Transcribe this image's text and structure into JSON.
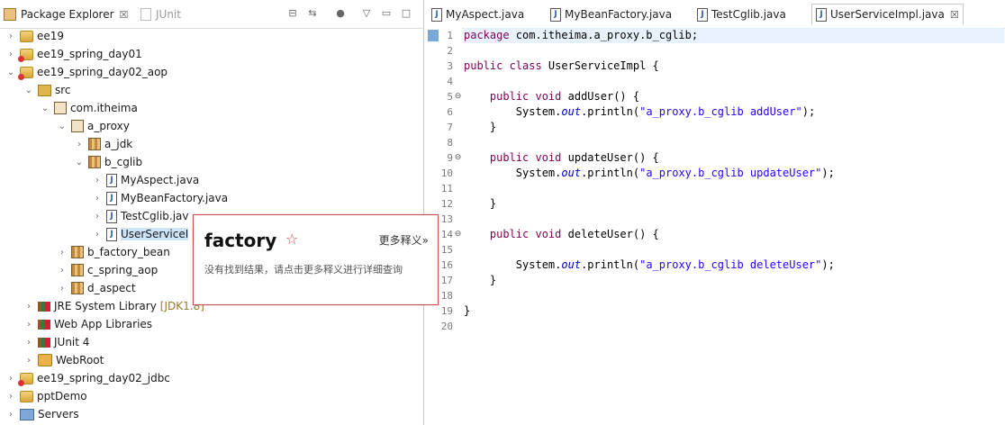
{
  "explorer": {
    "tabs": [
      {
        "label": "Package Explorer",
        "close": "☒",
        "active": true
      },
      {
        "label": "JUnit",
        "active": false
      }
    ],
    "toolbar_icons": [
      "collapse-all-icon",
      "link-with-editor-icon",
      "view-menu-icon",
      "minimize-icon",
      "maximize-icon"
    ],
    "tree": [
      {
        "label": "ee19",
        "icon": "project-icon",
        "expanded": false,
        "error": false
      },
      {
        "label": "ee19_spring_day01",
        "icon": "project-icon",
        "expanded": false,
        "error": true
      },
      {
        "label": "ee19_spring_day02_aop",
        "icon": "project-icon",
        "expanded": true,
        "error": true
      },
      {
        "label": "src",
        "icon": "source-folder-icon",
        "expanded": true
      },
      {
        "label": "com.itheima",
        "icon": "package-icon",
        "expanded": true
      },
      {
        "label": "a_proxy",
        "icon": "package-icon",
        "expanded": true
      },
      {
        "label": "a_jdk",
        "icon": "package-icon",
        "expanded": false
      },
      {
        "label": "b_cglib",
        "icon": "package-icon",
        "expanded": true
      },
      {
        "label": "MyAspect.java",
        "icon": "java-file-icon",
        "expanded": false
      },
      {
        "label": "MyBeanFactory.java",
        "icon": "java-file-icon",
        "expanded": false
      },
      {
        "label": "TestCglib.jav",
        "icon": "java-file-icon",
        "expanded": false
      },
      {
        "label": "UserServiceI",
        "icon": "java-file-icon",
        "expanded": false,
        "selected": true
      },
      {
        "label": "b_factory_bean",
        "icon": "package-icon",
        "expanded": false
      },
      {
        "label": "c_spring_aop",
        "icon": "package-icon",
        "expanded": false
      },
      {
        "label": "d_aspect",
        "icon": "package-icon",
        "expanded": false
      },
      {
        "label": "JRE System Library",
        "decoration": "[JDK1.8]",
        "icon": "library-icon",
        "expanded": false
      },
      {
        "label": "Web App Libraries",
        "icon": "library-icon",
        "expanded": false
      },
      {
        "label": "JUnit 4",
        "icon": "library-icon",
        "expanded": false
      },
      {
        "label": "WebRoot",
        "icon": "web-folder-icon",
        "expanded": false
      },
      {
        "label": "ee19_spring_day02_jdbc",
        "icon": "project-icon",
        "expanded": false,
        "error": true
      },
      {
        "label": "pptDemo",
        "icon": "project-icon",
        "expanded": false,
        "error": false
      },
      {
        "label": "Servers",
        "icon": "servers-folder-icon",
        "expanded": false
      }
    ]
  },
  "editor": {
    "tabs": [
      {
        "label": "MyAspect.java",
        "active": false
      },
      {
        "label": "MyBeanFactory.java",
        "active": false
      },
      {
        "label": "TestCglib.java",
        "active": false
      },
      {
        "label": "UserServiceImpl.java",
        "active": true,
        "close": "☒"
      }
    ],
    "lines": [
      {
        "n": "1",
        "fold": "",
        "tokens": [
          {
            "t": "package",
            "c": "kw"
          },
          {
            "t": " com.itheima.a_proxy.b_cglib;",
            "c": ""
          }
        ]
      },
      {
        "n": "2",
        "fold": "",
        "tokens": []
      },
      {
        "n": "3",
        "fold": "",
        "tokens": [
          {
            "t": "public class",
            "c": "kw"
          },
          {
            "t": " UserServiceImpl {",
            "c": ""
          }
        ]
      },
      {
        "n": "4",
        "fold": "",
        "tokens": []
      },
      {
        "n": "5",
        "fold": "⊖",
        "tokens": [
          {
            "t": "    ",
            "c": ""
          },
          {
            "t": "public void",
            "c": "kw"
          },
          {
            "t": " addUser() {",
            "c": ""
          }
        ]
      },
      {
        "n": "6",
        "fold": "",
        "tokens": [
          {
            "t": "        System.",
            "c": ""
          },
          {
            "t": "out",
            "c": "fld"
          },
          {
            "t": ".println(",
            "c": ""
          },
          {
            "t": "\"a_proxy.b_cglib addUser\"",
            "c": "str"
          },
          {
            "t": ");",
            "c": ""
          }
        ]
      },
      {
        "n": "7",
        "fold": "",
        "tokens": [
          {
            "t": "    }",
            "c": ""
          }
        ]
      },
      {
        "n": "8",
        "fold": "",
        "tokens": []
      },
      {
        "n": "9",
        "fold": "⊖",
        "tokens": [
          {
            "t": "    ",
            "c": ""
          },
          {
            "t": "public void",
            "c": "kw"
          },
          {
            "t": " updateUser() {",
            "c": ""
          }
        ]
      },
      {
        "n": "10",
        "fold": "",
        "tokens": [
          {
            "t": "        System.",
            "c": ""
          },
          {
            "t": "out",
            "c": "fld"
          },
          {
            "t": ".println(",
            "c": ""
          },
          {
            "t": "\"a_proxy.b_cglib updateUser\"",
            "c": "str"
          },
          {
            "t": ");",
            "c": ""
          }
        ]
      },
      {
        "n": "11",
        "fold": "",
        "tokens": []
      },
      {
        "n": "12",
        "fold": "",
        "tokens": [
          {
            "t": "    }",
            "c": ""
          }
        ]
      },
      {
        "n": "13",
        "fold": "",
        "tokens": []
      },
      {
        "n": "14",
        "fold": "⊖",
        "tokens": [
          {
            "t": "    ",
            "c": ""
          },
          {
            "t": "public void",
            "c": "kw"
          },
          {
            "t": " deleteUser() {",
            "c": ""
          }
        ]
      },
      {
        "n": "15",
        "fold": "",
        "tokens": []
      },
      {
        "n": "16",
        "fold": "",
        "tokens": [
          {
            "t": "        System.",
            "c": ""
          },
          {
            "t": "out",
            "c": "fld"
          },
          {
            "t": ".println(",
            "c": ""
          },
          {
            "t": "\"a_proxy.b_cglib deleteUser\"",
            "c": "str"
          },
          {
            "t": ");",
            "c": ""
          }
        ]
      },
      {
        "n": "17",
        "fold": "",
        "tokens": [
          {
            "t": "    }",
            "c": ""
          }
        ]
      },
      {
        "n": "18",
        "fold": "",
        "tokens": []
      },
      {
        "n": "19",
        "fold": "",
        "tokens": [
          {
            "t": "}",
            "c": ""
          }
        ]
      },
      {
        "n": "20",
        "fold": "",
        "tokens": []
      }
    ]
  },
  "popup": {
    "word": "factory",
    "star": "☆",
    "more_link": "更多释义»",
    "message": "没有找到结果，请点击更多释义进行详细查询"
  },
  "colors": {
    "keyword": "#7f0055",
    "string": "#2a00ff",
    "field": "#0000c0",
    "popup_border": "#d14848",
    "selection": "#cde4f7"
  }
}
